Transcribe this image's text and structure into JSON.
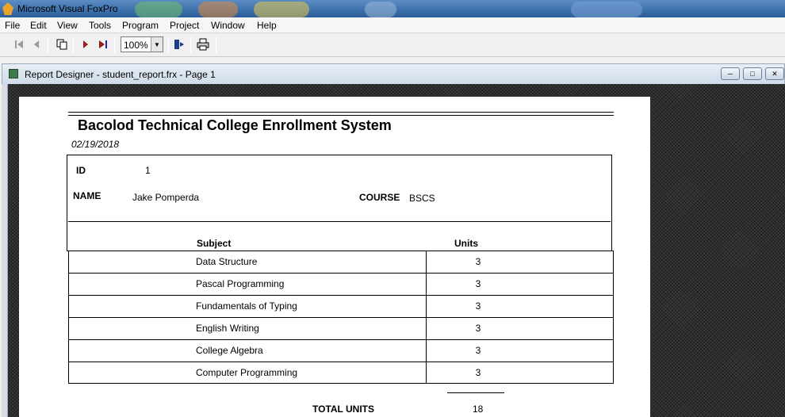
{
  "app": {
    "title": "Microsoft Visual FoxPro"
  },
  "menu": [
    "File",
    "Edit",
    "View",
    "Tools",
    "Program",
    "Project",
    "Window",
    "Help"
  ],
  "toolbar": {
    "zoom": "100%",
    "icons": [
      "first-page-icon",
      "previous-page-icon",
      "multipage-icon",
      "next-page-icon",
      "last-page-icon",
      "exit-preview-icon",
      "print-icon"
    ]
  },
  "window": {
    "title": "Report Designer - student_report.frx - Page 1"
  },
  "report": {
    "title": "Bacolod Technical College Enrollment System",
    "date": "02/19/2018",
    "id_label": "ID",
    "id_value": "1",
    "name_label": "NAME",
    "name_value": "Jake Pomperda",
    "course_label": "COURSE",
    "course_value": "BSCS",
    "subject_header": "Subject",
    "units_header": "Units",
    "rows": [
      {
        "subject": "Data Structure",
        "units": "3"
      },
      {
        "subject": "Pascal Programming",
        "units": "3"
      },
      {
        "subject": "Fundamentals of Typing",
        "units": "3"
      },
      {
        "subject": "English Writing",
        "units": "3"
      },
      {
        "subject": "College Algebra",
        "units": "3"
      },
      {
        "subject": "Computer Programming",
        "units": "3"
      }
    ],
    "total_label": "TOTAL UNITS",
    "total_value": "18"
  }
}
